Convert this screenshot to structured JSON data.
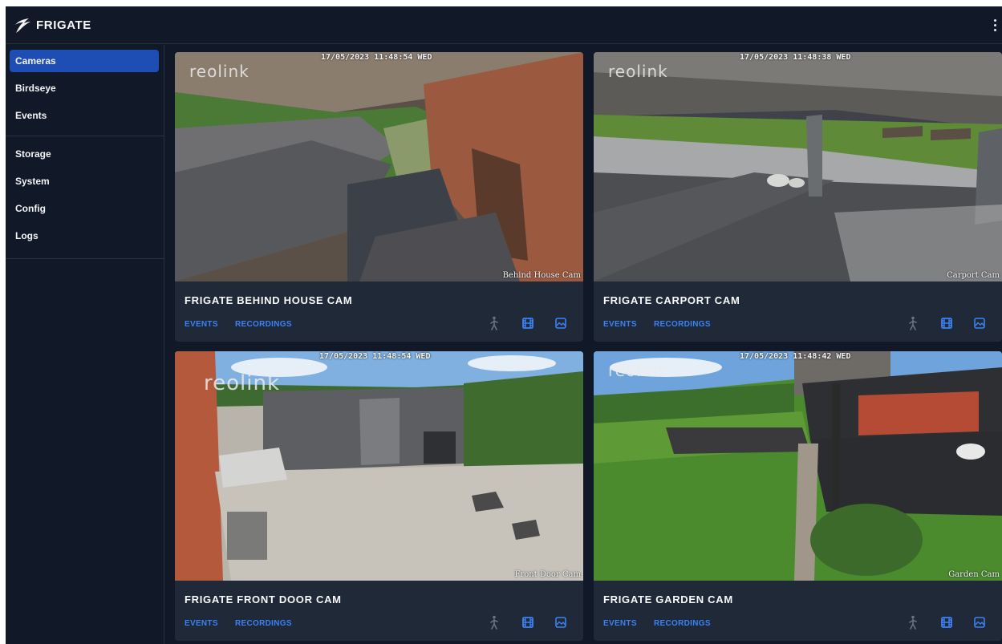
{
  "app": {
    "title": "FRIGATE",
    "logo_icon": "frigate-bird-icon",
    "menu_icon": "vertical-dots-icon"
  },
  "sidebar": {
    "items": [
      {
        "label": "Cameras",
        "active": true
      },
      {
        "label": "Birdseye",
        "active": false
      },
      {
        "label": "Events",
        "active": false
      },
      {
        "label": "Storage",
        "active": false
      },
      {
        "label": "System",
        "active": false
      },
      {
        "label": "Config",
        "active": false
      },
      {
        "label": "Logs",
        "active": false
      }
    ]
  },
  "colors": {
    "background": "#111827",
    "card": "#1f2937",
    "accent": "#3b82f6",
    "active_nav": "#1e4db3"
  },
  "cameras": [
    {
      "title": "FRIGATE BEHIND HOUSE CAM",
      "timestamp": "17/05/2023 11:48:54 WED",
      "brand": "reolink",
      "overlay": "Behind House Cam",
      "events_label": "EVENTS",
      "recordings_label": "RECORDINGS",
      "icons": [
        "person-icon",
        "film-icon",
        "snapshot-icon"
      ]
    },
    {
      "title": "FRIGATE CARPORT CAM",
      "timestamp": "17/05/2023 11:48:38 WED",
      "brand": "reolink",
      "overlay": "Carport Cam",
      "events_label": "EVENTS",
      "recordings_label": "RECORDINGS",
      "icons": [
        "person-icon",
        "film-icon",
        "snapshot-icon"
      ]
    },
    {
      "title": "FRIGATE FRONT DOOR CAM",
      "timestamp": "17/05/2023 11:48:54 WED",
      "brand": "reolink",
      "overlay": "Front Door Cam",
      "events_label": "EVENTS",
      "recordings_label": "RECORDINGS",
      "icons": [
        "person-icon",
        "film-icon",
        "snapshot-icon"
      ]
    },
    {
      "title": "FRIGATE GARDEN CAM",
      "timestamp": "17/05/2023 11:48:42 WED",
      "brand": "reolink",
      "overlay": "Garden Cam",
      "events_label": "EVENTS",
      "recordings_label": "RECORDINGS",
      "icons": [
        "person-icon",
        "film-icon",
        "snapshot-icon"
      ]
    }
  ]
}
